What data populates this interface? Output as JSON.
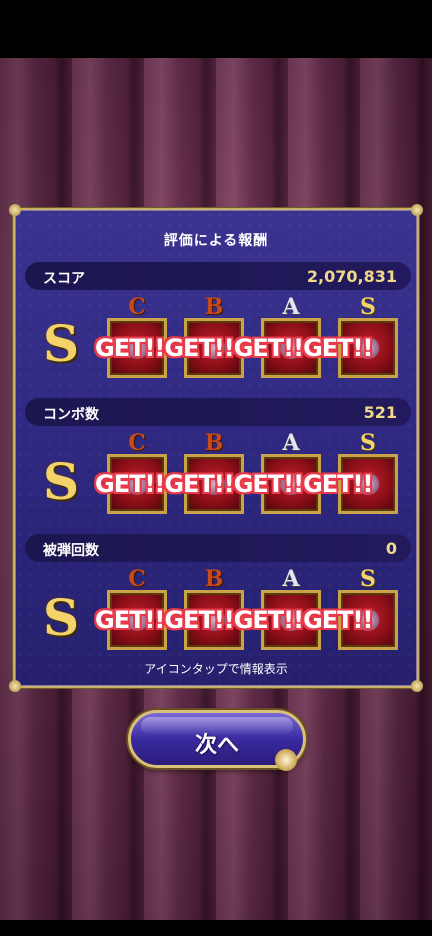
{
  "title": "評価による報酬",
  "rows": [
    {
      "label": "スコア",
      "value": "2,070,831",
      "rank": "S",
      "rewards": [
        {
          "grade": "C"
        },
        {
          "grade": "B"
        },
        {
          "grade": "A"
        },
        {
          "grade": "S"
        }
      ],
      "get_text": "GET!!GET!!GET!!GET!!"
    },
    {
      "label": "コンボ数",
      "value": "521",
      "rank": "S",
      "rewards": [
        {
          "grade": "C"
        },
        {
          "grade": "B"
        },
        {
          "grade": "A"
        },
        {
          "grade": "S"
        }
      ],
      "get_text": "GET!!GET!!GET!!GET!!"
    },
    {
      "label": "被弾回数",
      "value": "0",
      "rank": "S",
      "rewards": [
        {
          "grade": "C"
        },
        {
          "grade": "B"
        },
        {
          "grade": "A"
        },
        {
          "grade": "S"
        }
      ],
      "get_text": "GET!!GET!!GET!!GET!!"
    }
  ],
  "hint": "アイコンタップで情報表示",
  "next_button": "次へ",
  "colors": {
    "panel": "#2e2880",
    "gold": "#c9b06a",
    "get_outline": "#e83a4a",
    "reward_box": "#8a0e18"
  }
}
